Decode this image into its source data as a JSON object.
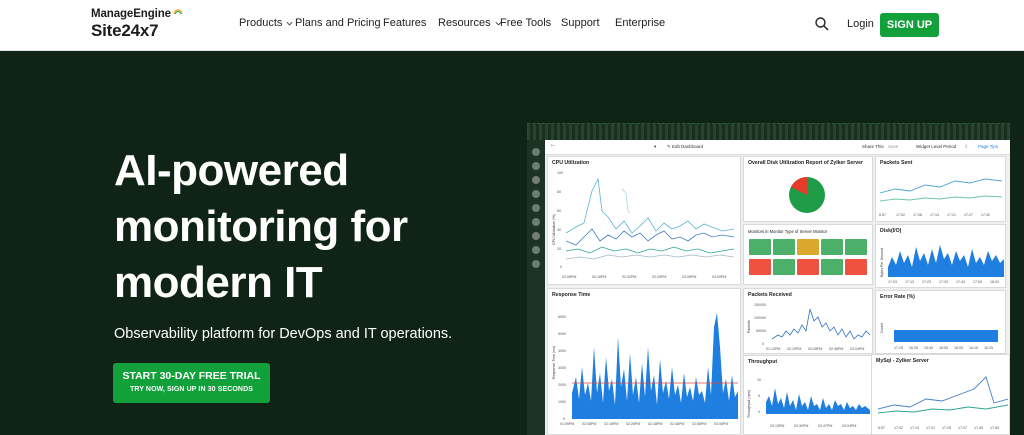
{
  "header": {
    "logo_brand": "ManageEngine",
    "logo_product": "Site24x7",
    "nav": [
      {
        "label": "Products",
        "has_dropdown": true
      },
      {
        "label": "Plans and Pricing",
        "has_dropdown": false
      },
      {
        "label": "Features",
        "has_dropdown": false
      },
      {
        "label": "Resources",
        "has_dropdown": true
      },
      {
        "label": "Free Tools",
        "has_dropdown": false
      },
      {
        "label": "Support",
        "has_dropdown": false
      },
      {
        "label": "Enterprise",
        "has_dropdown": false
      }
    ],
    "search_icon": "search-icon",
    "login_label": "Login",
    "signup_label": "SIGN UP"
  },
  "hero": {
    "title_lines": [
      "AI-powered",
      "monitoring for",
      "modern IT"
    ],
    "subtitle": "Observability platform for DevOps and IT operations.",
    "cta_primary": "START 30-DAY FREE TRIAL",
    "cta_secondary": "TRY NOW, SIGN UP IN 30 SECONDS"
  },
  "dashboard": {
    "toolbar": {
      "edit_label": "Edit Dashboard",
      "share_label": "Share This",
      "save_label": "Save",
      "period_label": "Widget Level Period",
      "page_label": "Page Tips"
    },
    "cpu": {
      "title": "CPU Utilization",
      "ylabel": "CPU Utilization (%)",
      "yticks": [
        "100",
        "80",
        "60",
        "40",
        "20",
        "0"
      ],
      "xticks": [
        "02:08PM",
        "02:16PM",
        "02:32PM",
        "02:43PM",
        "03:05PM",
        "03:09PM"
      ]
    },
    "disk_report": {
      "title": "Overall Disk Utilization Report of Zylker Server"
    },
    "packets_sent": {
      "title": "Packets Sent",
      "xticks": [
        "6:57",
        "17:02",
        "17:08",
        "17:13",
        "17:21",
        "17:27",
        "17:32"
      ]
    },
    "monitors": {
      "title": "Monitors in Monitor Type of Server Monitor",
      "tiles": [
        "green",
        "green",
        "yellow",
        "green",
        "green",
        "red",
        "green",
        "red",
        "green",
        "red"
      ]
    },
    "disk_io": {
      "title": "Disk(I/O)",
      "ylabel": "Bytes Per Second",
      "xticks": [
        "17:03",
        "17:13",
        "17:23",
        "17:33",
        "17:43",
        "17:53",
        "18:03"
      ]
    },
    "response_time": {
      "title": "Response Time",
      "ylabel": "Response Time (ms)",
      "yticks": [
        "6000",
        "5000",
        "4000",
        "3000",
        "2000",
        "1000",
        "0"
      ],
      "xticks": [
        "01:59PM",
        "02:08PM",
        "02:18PM",
        "02:28PM",
        "02:38PM",
        "02:48PM",
        "02:58PM",
        "03:08PM"
      ]
    },
    "packets_received": {
      "title": "Packets Received",
      "ylabel": "Packets",
      "yticks": [
        "150000",
        "100000",
        "50000",
        "0"
      ],
      "xticks": [
        "01:12PM",
        "02:10PM",
        "02:28PM",
        "02:46PM",
        "03:04PM"
      ]
    },
    "error_rate": {
      "title": "Error Rate (%)",
      "ylabel": "Count",
      "xticks": [
        "17:25",
        "16:35",
        "15:45",
        "16:55",
        "16:05",
        "16:15",
        "16:25"
      ]
    },
    "throughput": {
      "title": "Throughput",
      "ylabel": "Throughput (rpm)",
      "yticks": [
        "10",
        "5",
        "0"
      ],
      "xticks": [
        "02:13PM",
        "02:30PM",
        "02:47PM",
        "03:04PM"
      ]
    },
    "mysql": {
      "title": "MySql - Zylker Server",
      "xticks": [
        "6:57",
        "17:02",
        "17:13",
        "17:21",
        "17:29",
        "17:37",
        "17:45",
        "17:55"
      ]
    }
  },
  "colors": {
    "brand_green": "#12a03a",
    "hero_bg": "#0f2416",
    "chart_blue": "#1e7fe0",
    "tile_green": "#4caf6a",
    "tile_red": "#ef5340",
    "tile_yellow": "#d9a72b"
  }
}
